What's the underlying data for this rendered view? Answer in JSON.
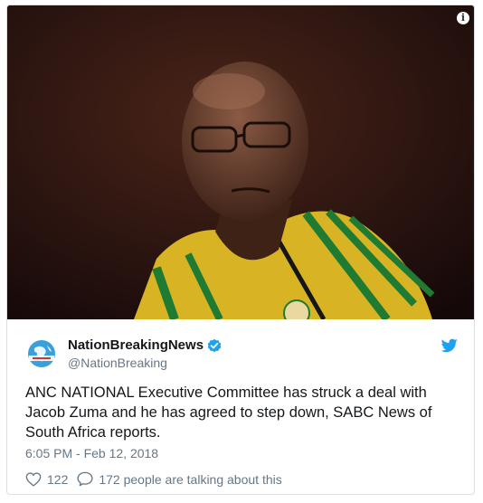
{
  "media": {
    "info_icon": "info-icon",
    "info_glyph": "i",
    "colors": {
      "background": "#241010",
      "shirt_yellow": "#e3c52b",
      "shirt_green": "#1f7a32"
    }
  },
  "tweet": {
    "display_name": "NationBreakingNews",
    "handle": "@NationBreaking",
    "verified": true,
    "text": "ANC NATIONAL Executive Committee has struck a deal with Jacob Zuma and he has agreed to step down, SABC News of South Africa reports.",
    "timestamp": "6:05 PM - Feb 12, 2018",
    "likes": "122",
    "talking": "172 people are talking about this",
    "colors": {
      "brand_blue": "#1da1f2",
      "text": "#14171a",
      "muted": "#657786"
    }
  }
}
